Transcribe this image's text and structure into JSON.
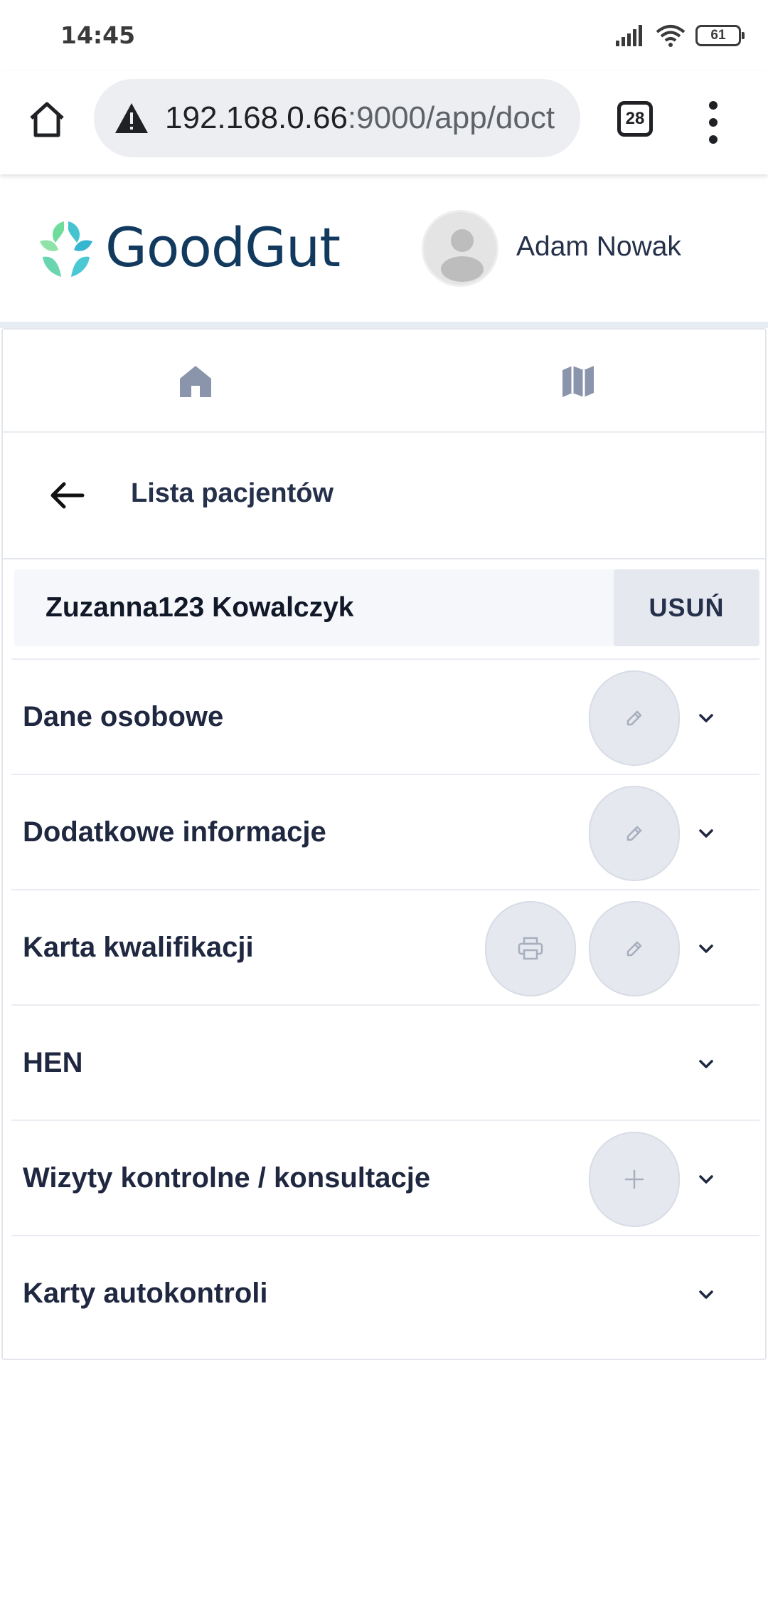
{
  "status_bar": {
    "time": "14:45",
    "battery": "61",
    "icons": [
      "signal-icon",
      "wifi-icon",
      "battery-icon"
    ]
  },
  "browser": {
    "url_host": "192.168.0.66",
    "url_path": ":9000/app/doct",
    "tab_count": "28",
    "icons": [
      "home-icon",
      "warning-icon",
      "tabs-icon",
      "more-vert-icon"
    ]
  },
  "app": {
    "brand": "GoodGut",
    "user_name": "Adam Nowak",
    "colors": {
      "brand_text": "#123a5e",
      "logo_green": "#6fdc9c",
      "logo_teal": "#43c4d0"
    }
  },
  "nav": {
    "icons": [
      "home-icon",
      "map-icon"
    ]
  },
  "page": {
    "back_title": "Lista pacjentów",
    "patient_name": "Zuzanna123 Kowalczyk",
    "delete_label": "USUŃ"
  },
  "sections": [
    {
      "title": "Dane osobowe",
      "actions": [
        "edit-icon"
      ]
    },
    {
      "title": "Dodatkowe informacje",
      "actions": [
        "edit-icon"
      ]
    },
    {
      "title": "Karta kwalifikacji",
      "actions": [
        "print-icon",
        "edit-icon"
      ]
    },
    {
      "title": "HEN",
      "actions": []
    },
    {
      "title": "Wizyty kontrolne / konsultacje",
      "actions": [
        "plus-icon"
      ]
    },
    {
      "title": "Karty autokontroli",
      "actions": []
    }
  ]
}
